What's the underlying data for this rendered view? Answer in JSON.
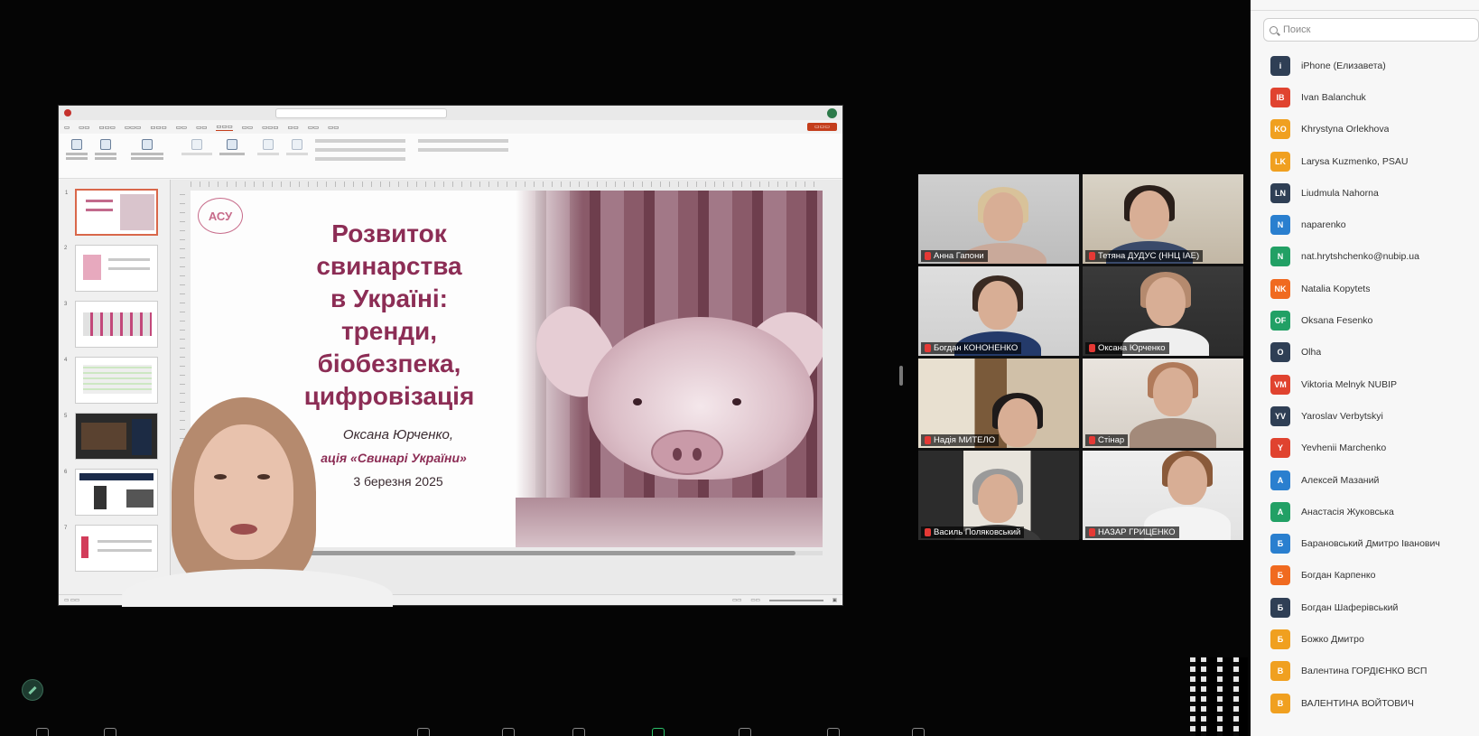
{
  "search": {
    "placeholder": "Поиск"
  },
  "slide": {
    "logo": "АСУ",
    "title_lines": [
      "Розвиток",
      "свинарства",
      "в Україні:",
      "тренди,",
      "біобезпека,",
      "цифровізація"
    ],
    "author": "Оксана Юрченко,",
    "org": "ація «Свинарі України»",
    "date": "3 березня 2025"
  },
  "gallery": [
    {
      "name": "Анна Гапони",
      "active": false
    },
    {
      "name": "Тетяна ДУДУС (ННЦ ІАЕ)",
      "active": false
    },
    {
      "name": "Богдан КОНОНЕНКО",
      "active": false
    },
    {
      "name": "Оксана Юрченко",
      "active": true
    },
    {
      "name": "Надія МИТЕЛО",
      "active": false
    },
    {
      "name": "Стінар",
      "active": false
    },
    {
      "name": "Василь Поляковський",
      "active": false
    },
    {
      "name": "НАЗАР ГРИЦЕНКО",
      "active": false
    }
  ],
  "participants": [
    {
      "initials": "i",
      "name": "iPhone (Елизавета)",
      "color": "#2f3f55"
    },
    {
      "initials": "IB",
      "name": "Ivan Balanchuk",
      "color": "#e0432f"
    },
    {
      "initials": "KO",
      "name": "Khrystyna Orlekhova",
      "color": "#f0a020"
    },
    {
      "initials": "LK",
      "name": "Larysa Kuzmenko, PSAU",
      "color": "#f0a020"
    },
    {
      "initials": "LN",
      "name": "Liudmula Nahorna",
      "color": "#2f3f55"
    },
    {
      "initials": "N",
      "name": "naparenko",
      "color": "#2a7fcf"
    },
    {
      "initials": "N",
      "name": "nat.hrytshchenko@nubip.ua",
      "color": "#22a065"
    },
    {
      "initials": "NK",
      "name": "Natalia Kopytets",
      "color": "#f06a20"
    },
    {
      "initials": "OF",
      "name": "Oksana Fesenko",
      "color": "#22a065"
    },
    {
      "initials": "O",
      "name": "Olha",
      "color": "#2f3f55"
    },
    {
      "initials": "VM",
      "name": "Viktoria Melnyk NUBIP",
      "color": "#e0432f"
    },
    {
      "initials": "YV",
      "name": "Yaroslav Verbytskyi",
      "color": "#2f3f55"
    },
    {
      "initials": "Y",
      "name": "Yevhenii Marchenko",
      "color": "#e0432f"
    },
    {
      "initials": "А",
      "name": "Алексей Мазаний",
      "color": "#2a7fcf"
    },
    {
      "initials": "А",
      "name": "Анастасія Жуковська",
      "color": "#22a065"
    },
    {
      "initials": "Б",
      "name": "Барановський Дмитро Іванович",
      "color": "#2a7fcf"
    },
    {
      "initials": "Б",
      "name": "Богдан Карпенко",
      "color": "#f06a20"
    },
    {
      "initials": "Б",
      "name": "Богдан Шаферівський",
      "color": "#2f3f55"
    },
    {
      "initials": "Б",
      "name": "Божко Дмитро",
      "color": "#f0a020"
    },
    {
      "initials": "В",
      "name": "Валентина ГОРДІЄНКО ВСП",
      "color": "#f0a020"
    },
    {
      "initials": "В",
      "name": "ВАЛЕНТИНА ВОЙТОВИЧ",
      "color": "#f0a020"
    }
  ],
  "colors": {
    "accent": "#8c2d55",
    "active_speaker": "#2cc36b",
    "mic_off": "#e53935"
  }
}
